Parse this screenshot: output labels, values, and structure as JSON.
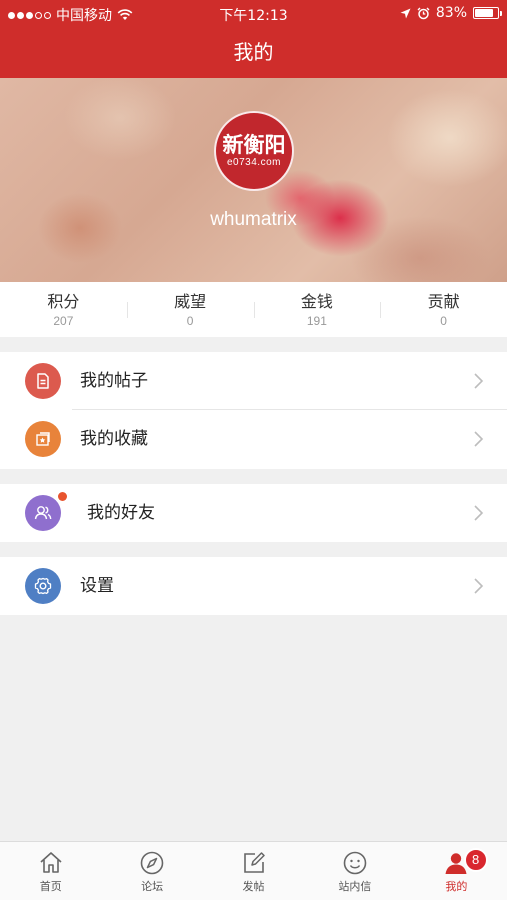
{
  "status_bar": {
    "carrier": "中国移动",
    "time": "下午12:13",
    "battery": "83%",
    "battery_level": 0.83
  },
  "nav": {
    "title": "我的"
  },
  "profile": {
    "avatar_logo_main": "新衡阳",
    "avatar_logo_sub": "e0734.com",
    "username": "whumatrix"
  },
  "stats": [
    {
      "label": "积分",
      "value": "207"
    },
    {
      "label": "威望",
      "value": "0"
    },
    {
      "label": "金钱",
      "value": "191"
    },
    {
      "label": "贡献",
      "value": "0"
    }
  ],
  "menu": {
    "posts": {
      "label": "我的帖子",
      "icon": "document-icon",
      "color": "#dc5a4e"
    },
    "favorites": {
      "label": "我的收藏",
      "icon": "favorites-icon",
      "color": "#e8833a"
    },
    "friends": {
      "label": "我的好友",
      "icon": "friends-icon",
      "color": "#8f6fce"
    },
    "settings": {
      "label": "设置",
      "icon": "gear-icon",
      "color": "#4f7fc4"
    }
  },
  "tabbar": [
    {
      "label": "首页",
      "icon": "home-icon"
    },
    {
      "label": "论坛",
      "icon": "compass-icon"
    },
    {
      "label": "发帖",
      "icon": "compose-icon"
    },
    {
      "label": "站内信",
      "icon": "smiley-icon"
    },
    {
      "label": "我的",
      "icon": "user-icon",
      "active": true,
      "badge": "8"
    }
  ],
  "colors": {
    "brand_red": "#cf2d2b",
    "background": "#f0f0f0"
  }
}
